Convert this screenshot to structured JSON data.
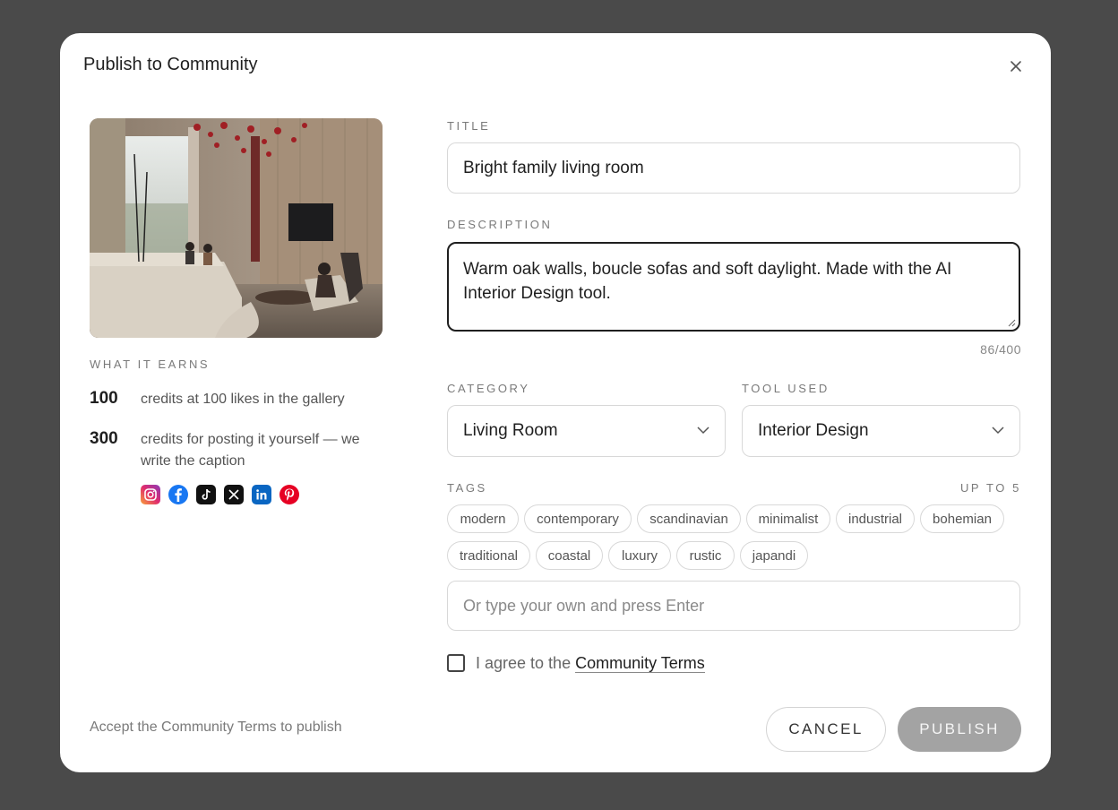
{
  "modal": {
    "title": "Publish to Community",
    "close_icon": "close-icon"
  },
  "earnings": {
    "label": "WHAT IT EARNS",
    "rows": [
      {
        "amount": "100",
        "text": "credits at 100 likes in the gallery"
      },
      {
        "amount": "300",
        "text": "credits for posting it yourself — we write the caption"
      }
    ],
    "social_icons": [
      "instagram-icon",
      "facebook-icon",
      "tiktok-icon",
      "x-icon",
      "linkedin-icon",
      "pinterest-icon"
    ]
  },
  "form": {
    "title_label": "TITLE",
    "title_value": "Bright family living room",
    "description_label": "DESCRIPTION",
    "description_value": "Warm oak walls, boucle sofas and soft daylight. Made with the AI Interior Design tool.",
    "description_counter": "86/400",
    "category_label": "CATEGORY",
    "category_value": "Living Room",
    "tool_label": "TOOL USED",
    "tool_value": "Interior Design",
    "tags_label": "TAGS",
    "tags_limit": "UP TO 5",
    "tags": [
      "modern",
      "contemporary",
      "scandinavian",
      "minimalist",
      "industrial",
      "bohemian",
      "traditional",
      "coastal",
      "luxury",
      "rustic",
      "japandi"
    ],
    "custom_tag_placeholder": "Or type your own and press Enter",
    "agree_prefix": "I agree to the ",
    "agree_link": "Community Terms"
  },
  "footer": {
    "note": "Accept the Community Terms to publish",
    "cancel_label": "CANCEL",
    "publish_label": "PUBLISH"
  },
  "colors": {
    "overlay": "#4a4a4a",
    "modal_bg": "#ffffff",
    "publish_disabled": "#a3a3a3"
  }
}
